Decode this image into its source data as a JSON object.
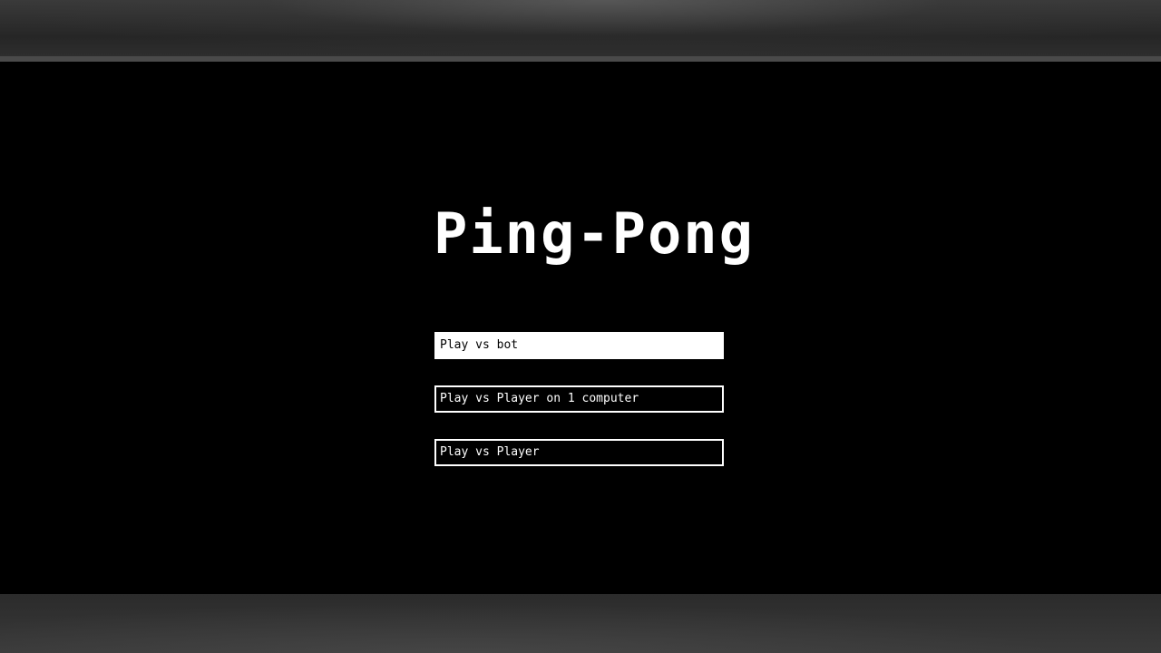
{
  "game": {
    "title": "Ping-Pong"
  },
  "menu": {
    "items": [
      {
        "label": "Play vs bot",
        "selected": true
      },
      {
        "label": "Play vs Player on 1 computer",
        "selected": false
      },
      {
        "label": "Play vs Player",
        "selected": false
      }
    ]
  },
  "colors": {
    "background": "#000000",
    "foreground": "#ffffff"
  }
}
